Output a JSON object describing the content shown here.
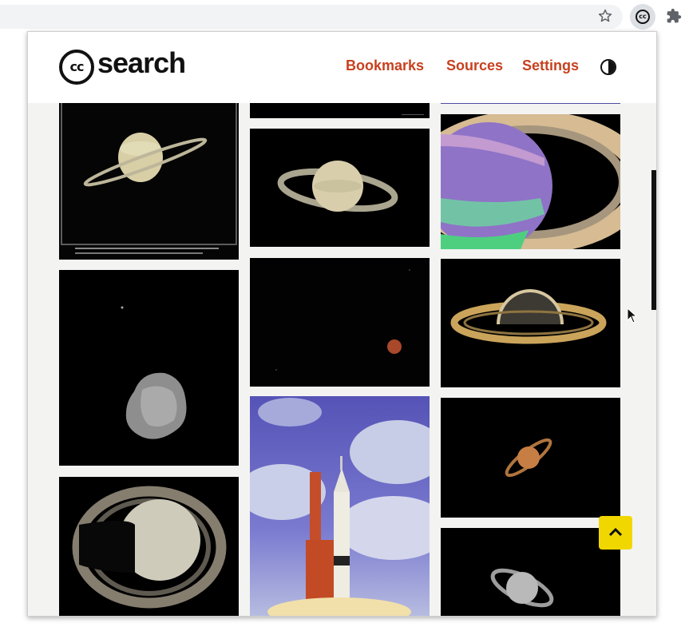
{
  "browser": {
    "star_icon": "star-icon",
    "extension_icon": "creative-commons-icon",
    "extension_label": "cc",
    "extensions_icon": "puzzle-icon"
  },
  "popup": {
    "logo": {
      "mark": "cc",
      "word": "search"
    },
    "nav": {
      "bookmarks": "Bookmarks",
      "sources": "Sources",
      "settings": "Settings"
    },
    "theme_icon": "contrast-icon",
    "scroll_top_icon": "chevron-up-icon"
  },
  "results": {
    "columns": [
      [
        "Saturn with tilted rings, telescope photo",
        "Rocky asteroid moon",
        "Saturn with rings, Cassini view"
      ],
      [
        "Saturn (top cropped)",
        "Saturn with rings on black",
        "Red planet in dark sky",
        "Rocket on launch pad"
      ],
      [
        "Saturn false-color rings",
        "Saturn backlit rings",
        "Saturn orange telescope",
        "Saturn grey telescope"
      ]
    ]
  },
  "colors": {
    "nav_link": "#c7411f",
    "scroll_top_button": "#f1d700",
    "grid_background": "#f3f3f2"
  }
}
